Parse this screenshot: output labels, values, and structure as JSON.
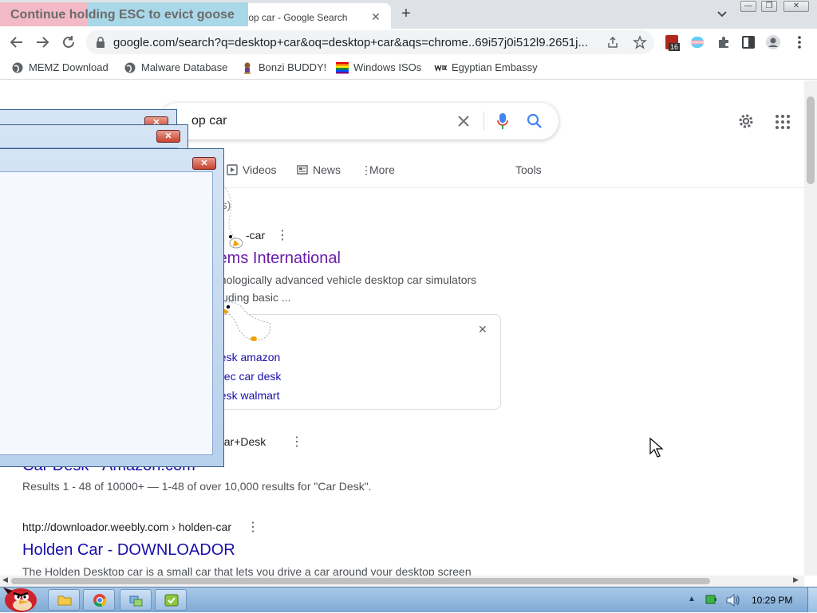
{
  "browser": {
    "tab_title": "top car - Google Search",
    "url": "google.com/search?q=desktop+car&oq=desktop+car&aqs=chrome..69i57j0i512l9.2651j...",
    "extension_badge": "16",
    "bookmarks": [
      {
        "label": "MEMZ Download",
        "icon": "globe-icon"
      },
      {
        "label": "Malware Database",
        "icon": "globe-icon"
      },
      {
        "label": "Bonzi BUDDY!",
        "icon": "bonzi-icon"
      },
      {
        "label": "Windows ISOs",
        "icon": "rainbow-flag-icon"
      },
      {
        "label": "Egyptian Embassy",
        "icon": "wix-icon"
      }
    ]
  },
  "goose_banner": "Continue holding ESC to evict goose",
  "search": {
    "query_visible": "op car",
    "tabs": [
      "Videos",
      "News",
      "More"
    ],
    "tools": "Tools",
    "result_stats": "nds)",
    "result1": {
      "cite": "-car",
      "title": "tems International",
      "snippet1": "hnologically advanced vehicle desktop car simulators",
      "snippet2": "cluding basic ..."
    },
    "related": [
      "desk amazon",
      "exec car desk",
      "desk walmart"
    ],
    "result2": {
      "cite": "-Car+Desk",
      "title": "Car Desk - Amazon.com",
      "snippet": "Results 1 - 48 of 10000+ — 1-48 of over 10,000 results for \"Car Desk\"."
    },
    "result3": {
      "cite": "http://downloador.weebly.com › holden-car",
      "title": "Holden Car - DOWNLOADOR",
      "snippet": "The Holden Desktop car is a small car that lets you drive a car around your desktop screen"
    }
  },
  "taskbar": {
    "clock": "10:29 PM"
  },
  "colors": {
    "link": "#1a0dab",
    "visited": "#681da8",
    "google_blue": "#4285f4"
  }
}
